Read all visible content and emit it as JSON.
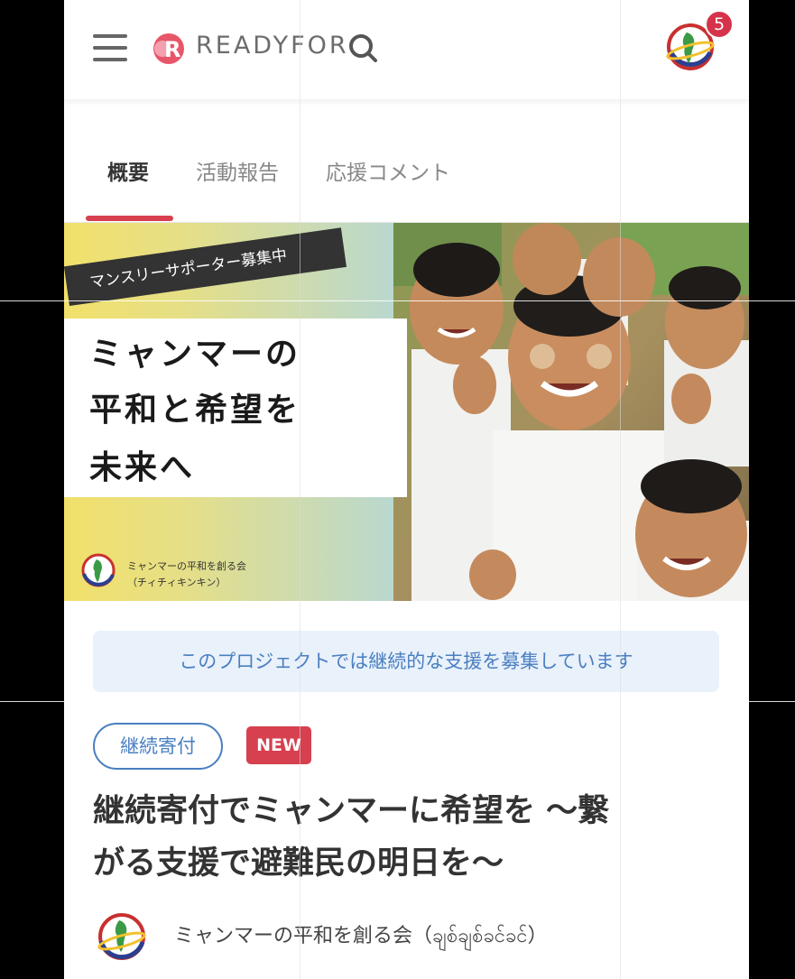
{
  "header": {
    "brand": "READYFOR",
    "notification_count": "5"
  },
  "tabs": [
    {
      "label": "概要",
      "active": true
    },
    {
      "label": "活動報告",
      "active": false
    },
    {
      "label": "応援コメント",
      "active": false
    }
  ],
  "hero": {
    "banner": "マンスリーサポーター募集中",
    "headline": [
      "ミャンマーの",
      "平和と希望を",
      "未来へ"
    ],
    "org_line1": "ミャンマーの平和を創る会",
    "org_line2": "（チィチィキンキン）"
  },
  "info_text": "このプロジェクトでは継続的な支援を募集しています",
  "tags": {
    "continuous": "継続寄付",
    "new": "NEW"
  },
  "title_lines": [
    "継続寄付でミャンマーに希望を ～繋",
    "がる支援で避難民の明日を～"
  ],
  "owner": {
    "name": "ミャンマーの平和を創る会（ချစ်ချစ်ခင်ခင်）"
  },
  "colors": {
    "accent_red": "#d6404f",
    "link_blue": "#4a7fc1",
    "info_bg": "#e9f1fb"
  }
}
